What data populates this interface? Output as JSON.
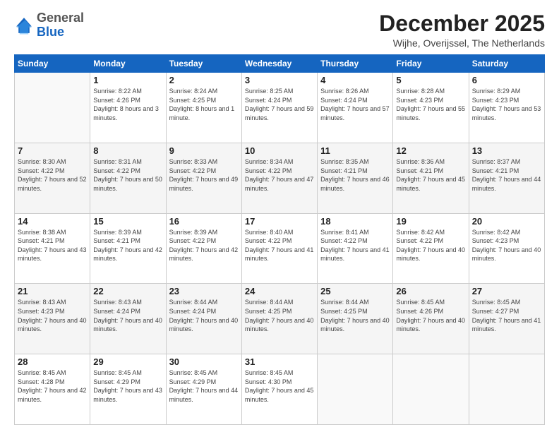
{
  "logo": {
    "general": "General",
    "blue": "Blue"
  },
  "header": {
    "month": "December 2025",
    "location": "Wijhe, Overijssel, The Netherlands"
  },
  "weekdays": [
    "Sunday",
    "Monday",
    "Tuesday",
    "Wednesday",
    "Thursday",
    "Friday",
    "Saturday"
  ],
  "weeks": [
    [
      {
        "day": "",
        "sunrise": "",
        "sunset": "",
        "daylight": ""
      },
      {
        "day": "1",
        "sunrise": "Sunrise: 8:22 AM",
        "sunset": "Sunset: 4:26 PM",
        "daylight": "Daylight: 8 hours and 3 minutes."
      },
      {
        "day": "2",
        "sunrise": "Sunrise: 8:24 AM",
        "sunset": "Sunset: 4:25 PM",
        "daylight": "Daylight: 8 hours and 1 minute."
      },
      {
        "day": "3",
        "sunrise": "Sunrise: 8:25 AM",
        "sunset": "Sunset: 4:24 PM",
        "daylight": "Daylight: 7 hours and 59 minutes."
      },
      {
        "day": "4",
        "sunrise": "Sunrise: 8:26 AM",
        "sunset": "Sunset: 4:24 PM",
        "daylight": "Daylight: 7 hours and 57 minutes."
      },
      {
        "day": "5",
        "sunrise": "Sunrise: 8:28 AM",
        "sunset": "Sunset: 4:23 PM",
        "daylight": "Daylight: 7 hours and 55 minutes."
      },
      {
        "day": "6",
        "sunrise": "Sunrise: 8:29 AM",
        "sunset": "Sunset: 4:23 PM",
        "daylight": "Daylight: 7 hours and 53 minutes."
      }
    ],
    [
      {
        "day": "7",
        "sunrise": "Sunrise: 8:30 AM",
        "sunset": "Sunset: 4:22 PM",
        "daylight": "Daylight: 7 hours and 52 minutes."
      },
      {
        "day": "8",
        "sunrise": "Sunrise: 8:31 AM",
        "sunset": "Sunset: 4:22 PM",
        "daylight": "Daylight: 7 hours and 50 minutes."
      },
      {
        "day": "9",
        "sunrise": "Sunrise: 8:33 AM",
        "sunset": "Sunset: 4:22 PM",
        "daylight": "Daylight: 7 hours and 49 minutes."
      },
      {
        "day": "10",
        "sunrise": "Sunrise: 8:34 AM",
        "sunset": "Sunset: 4:22 PM",
        "daylight": "Daylight: 7 hours and 47 minutes."
      },
      {
        "day": "11",
        "sunrise": "Sunrise: 8:35 AM",
        "sunset": "Sunset: 4:21 PM",
        "daylight": "Daylight: 7 hours and 46 minutes."
      },
      {
        "day": "12",
        "sunrise": "Sunrise: 8:36 AM",
        "sunset": "Sunset: 4:21 PM",
        "daylight": "Daylight: 7 hours and 45 minutes."
      },
      {
        "day": "13",
        "sunrise": "Sunrise: 8:37 AM",
        "sunset": "Sunset: 4:21 PM",
        "daylight": "Daylight: 7 hours and 44 minutes."
      }
    ],
    [
      {
        "day": "14",
        "sunrise": "Sunrise: 8:38 AM",
        "sunset": "Sunset: 4:21 PM",
        "daylight": "Daylight: 7 hours and 43 minutes."
      },
      {
        "day": "15",
        "sunrise": "Sunrise: 8:39 AM",
        "sunset": "Sunset: 4:21 PM",
        "daylight": "Daylight: 7 hours and 42 minutes."
      },
      {
        "day": "16",
        "sunrise": "Sunrise: 8:39 AM",
        "sunset": "Sunset: 4:22 PM",
        "daylight": "Daylight: 7 hours and 42 minutes."
      },
      {
        "day": "17",
        "sunrise": "Sunrise: 8:40 AM",
        "sunset": "Sunset: 4:22 PM",
        "daylight": "Daylight: 7 hours and 41 minutes."
      },
      {
        "day": "18",
        "sunrise": "Sunrise: 8:41 AM",
        "sunset": "Sunset: 4:22 PM",
        "daylight": "Daylight: 7 hours and 41 minutes."
      },
      {
        "day": "19",
        "sunrise": "Sunrise: 8:42 AM",
        "sunset": "Sunset: 4:22 PM",
        "daylight": "Daylight: 7 hours and 40 minutes."
      },
      {
        "day": "20",
        "sunrise": "Sunrise: 8:42 AM",
        "sunset": "Sunset: 4:23 PM",
        "daylight": "Daylight: 7 hours and 40 minutes."
      }
    ],
    [
      {
        "day": "21",
        "sunrise": "Sunrise: 8:43 AM",
        "sunset": "Sunset: 4:23 PM",
        "daylight": "Daylight: 7 hours and 40 minutes."
      },
      {
        "day": "22",
        "sunrise": "Sunrise: 8:43 AM",
        "sunset": "Sunset: 4:24 PM",
        "daylight": "Daylight: 7 hours and 40 minutes."
      },
      {
        "day": "23",
        "sunrise": "Sunrise: 8:44 AM",
        "sunset": "Sunset: 4:24 PM",
        "daylight": "Daylight: 7 hours and 40 minutes."
      },
      {
        "day": "24",
        "sunrise": "Sunrise: 8:44 AM",
        "sunset": "Sunset: 4:25 PM",
        "daylight": "Daylight: 7 hours and 40 minutes."
      },
      {
        "day": "25",
        "sunrise": "Sunrise: 8:44 AM",
        "sunset": "Sunset: 4:25 PM",
        "daylight": "Daylight: 7 hours and 40 minutes."
      },
      {
        "day": "26",
        "sunrise": "Sunrise: 8:45 AM",
        "sunset": "Sunset: 4:26 PM",
        "daylight": "Daylight: 7 hours and 40 minutes."
      },
      {
        "day": "27",
        "sunrise": "Sunrise: 8:45 AM",
        "sunset": "Sunset: 4:27 PM",
        "daylight": "Daylight: 7 hours and 41 minutes."
      }
    ],
    [
      {
        "day": "28",
        "sunrise": "Sunrise: 8:45 AM",
        "sunset": "Sunset: 4:28 PM",
        "daylight": "Daylight: 7 hours and 42 minutes."
      },
      {
        "day": "29",
        "sunrise": "Sunrise: 8:45 AM",
        "sunset": "Sunset: 4:29 PM",
        "daylight": "Daylight: 7 hours and 43 minutes."
      },
      {
        "day": "30",
        "sunrise": "Sunrise: 8:45 AM",
        "sunset": "Sunset: 4:29 PM",
        "daylight": "Daylight: 7 hours and 44 minutes."
      },
      {
        "day": "31",
        "sunrise": "Sunrise: 8:45 AM",
        "sunset": "Sunset: 4:30 PM",
        "daylight": "Daylight: 7 hours and 45 minutes."
      },
      {
        "day": "",
        "sunrise": "",
        "sunset": "",
        "daylight": ""
      },
      {
        "day": "",
        "sunrise": "",
        "sunset": "",
        "daylight": ""
      },
      {
        "day": "",
        "sunrise": "",
        "sunset": "",
        "daylight": ""
      }
    ]
  ]
}
